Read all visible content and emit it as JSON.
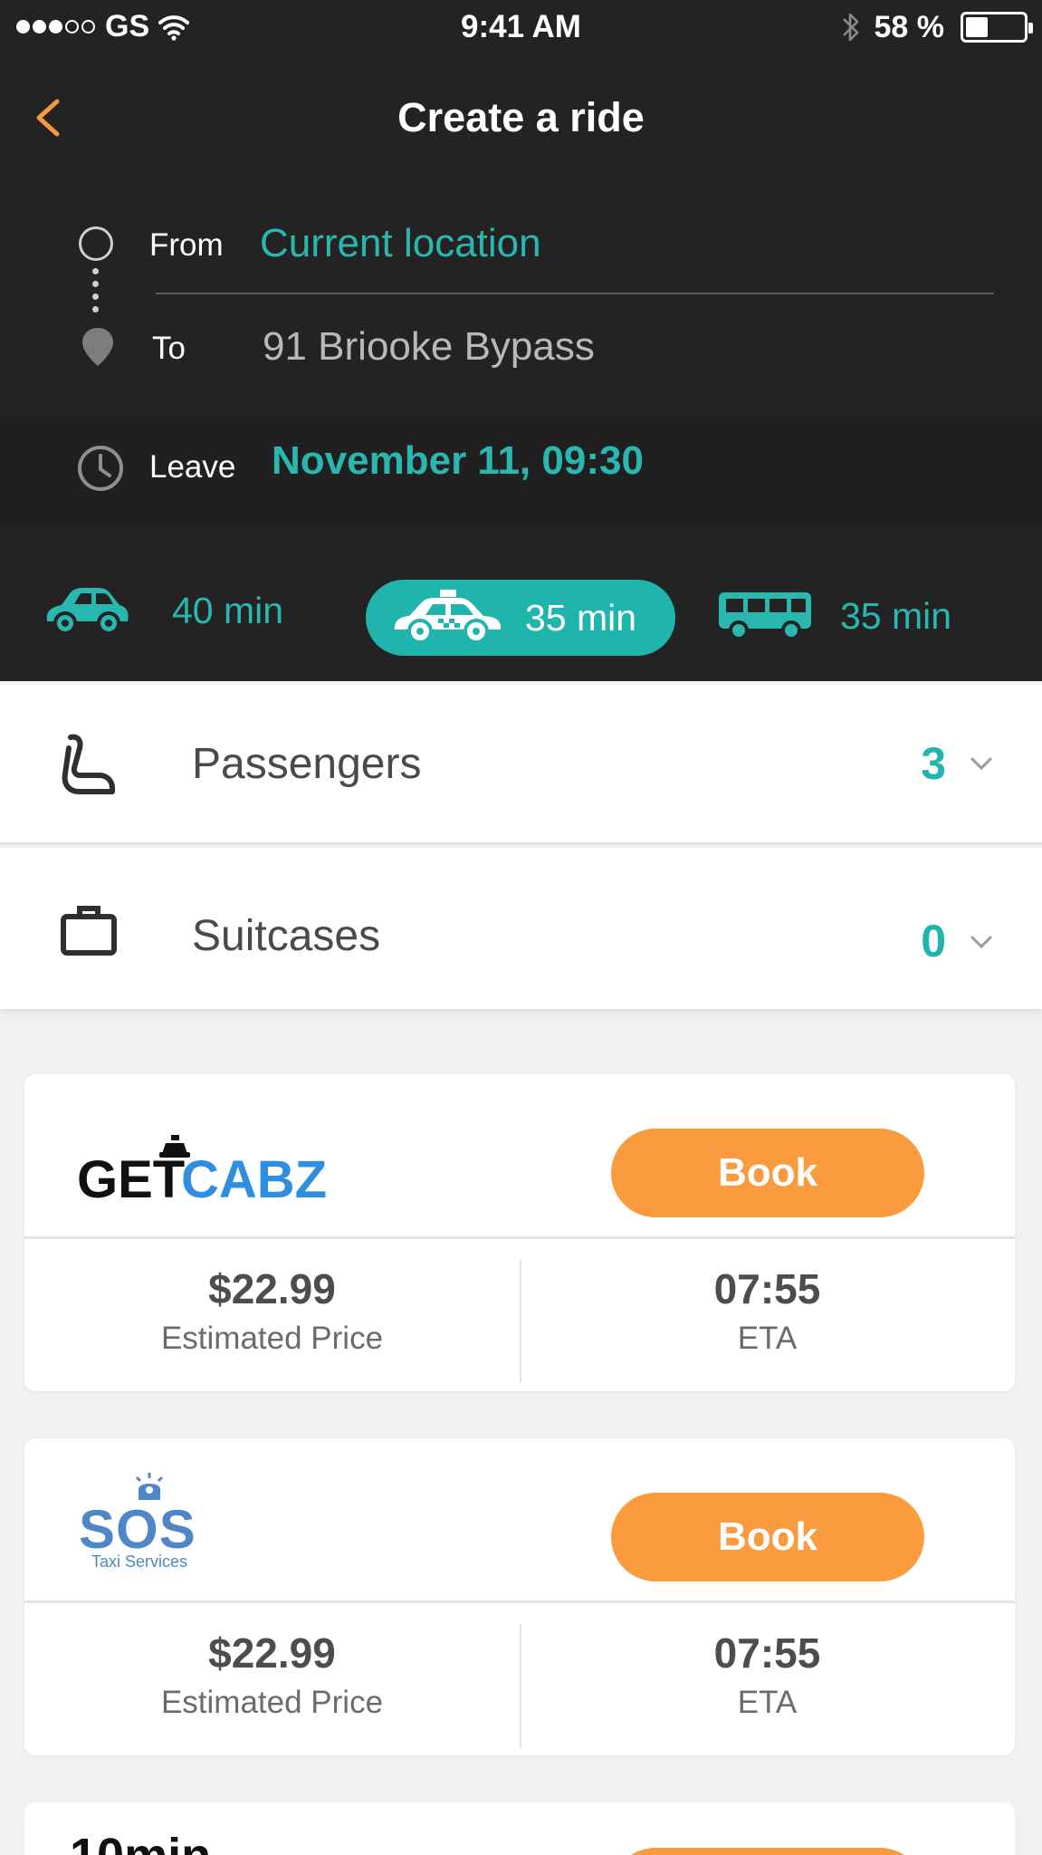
{
  "status_bar": {
    "carrier": "GS",
    "time": "9:41 AM",
    "battery": "58 %",
    "battery_level": 0.58
  },
  "header": {
    "title": "Create a ride"
  },
  "route": {
    "from_label": "From",
    "from_value": "Current location",
    "to_label": "To",
    "to_value": "91 Briooke Bypass"
  },
  "leave": {
    "label": "Leave",
    "value": "November 11, 09:30"
  },
  "modes": [
    {
      "type": "car",
      "icon": "car-icon",
      "time": "40 min",
      "selected": false
    },
    {
      "type": "taxi",
      "icon": "taxi-icon",
      "time": "35 min",
      "selected": true
    },
    {
      "type": "bus",
      "icon": "bus-icon",
      "time": "35 min",
      "selected": false
    }
  ],
  "options": {
    "passengers": {
      "label": "Passengers",
      "value": "3",
      "icon": "seat-icon"
    },
    "suitcases": {
      "label": "Suitcases",
      "value": "0",
      "icon": "suitcase-icon"
    }
  },
  "providers": [
    {
      "logo_part1": "GET",
      "logo_part2": "CABZ",
      "book_label": "Book",
      "price": "$22.99",
      "price_label": "Estimated Price",
      "eta": "07:55",
      "eta_label": "ETA"
    },
    {
      "logo_text": "SOS",
      "logo_sub": "Taxi Services",
      "book_label": "Book",
      "price": "$22.99",
      "price_label": "Estimated Price",
      "eta": "07:55",
      "eta_label": "ETA"
    },
    {
      "logo_text": "10min"
    }
  ],
  "colors": {
    "accent_teal": "#1fb5ac",
    "book_orange": "#fb9b3f",
    "back_orange": "#f39a3c",
    "header_bg": "#232323"
  }
}
